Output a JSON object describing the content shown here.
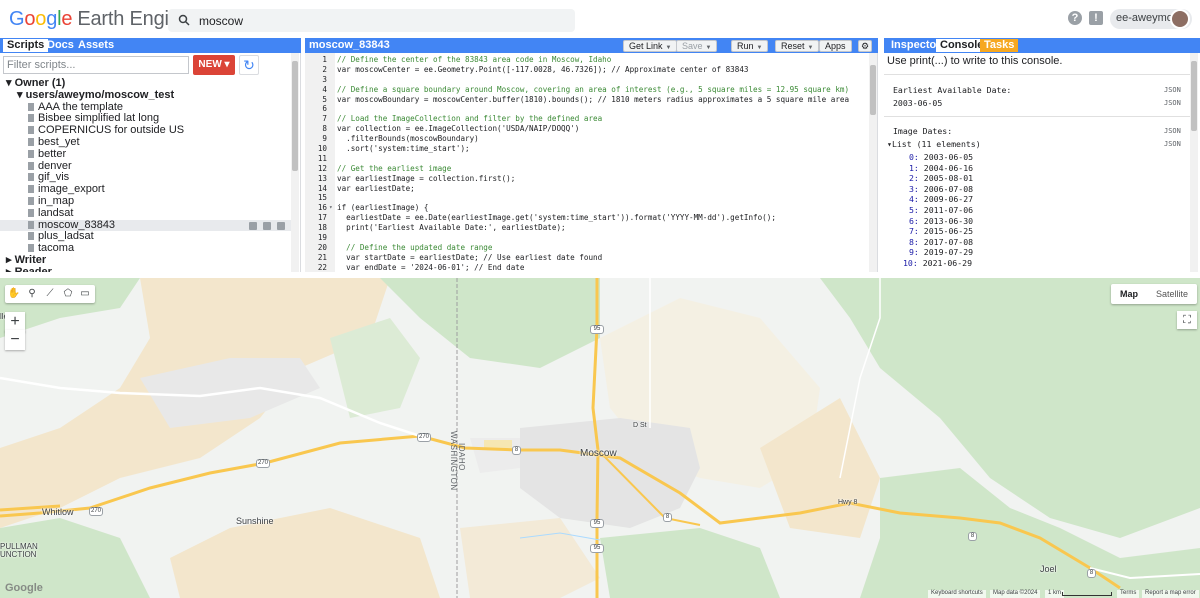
{
  "header": {
    "logo_google": "Google",
    "logo_product": "Earth Engine",
    "search_value": "moscow",
    "help_icon": "help-icon",
    "feedback_icon": "feedback-icon",
    "username": "ee-aweymoui"
  },
  "left_panel": {
    "tabs": [
      "Scripts",
      "Docs",
      "Assets"
    ],
    "filter_placeholder": "Filter scripts...",
    "new_label": "NEW",
    "tree": [
      {
        "label": "Owner (1)",
        "level": 0,
        "type": "group",
        "open": true
      },
      {
        "label": "users/aweymo/moscow_test",
        "level": 1,
        "type": "repo",
        "open": true
      },
      {
        "label": "AAA the template",
        "level": 2,
        "type": "file"
      },
      {
        "label": "Bisbee simplified lat long",
        "level": 2,
        "type": "file"
      },
      {
        "label": "COPERNICUS for outside US",
        "level": 2,
        "type": "file"
      },
      {
        "label": "best_yet",
        "level": 2,
        "type": "file"
      },
      {
        "label": "better",
        "level": 2,
        "type": "file"
      },
      {
        "label": "denver",
        "level": 2,
        "type": "file"
      },
      {
        "label": "gif_vis",
        "level": 2,
        "type": "file"
      },
      {
        "label": "image_export",
        "level": 2,
        "type": "file"
      },
      {
        "label": "in_map",
        "level": 2,
        "type": "file"
      },
      {
        "label": "landsat",
        "level": 2,
        "type": "file"
      },
      {
        "label": "moscow_83843",
        "level": 2,
        "type": "file",
        "selected": true
      },
      {
        "label": "plus_ladsat",
        "level": 2,
        "type": "file"
      },
      {
        "label": "tacoma",
        "level": 2,
        "type": "file"
      },
      {
        "label": "Writer",
        "level": 0,
        "type": "group",
        "open": false
      },
      {
        "label": "Reader",
        "level": 0,
        "type": "group",
        "open": false
      }
    ]
  },
  "editor": {
    "title": "moscow_83843",
    "buttons": {
      "get_link": "Get Link",
      "save": "Save",
      "run": "Run",
      "reset": "Reset",
      "apps": "Apps"
    },
    "lines": [
      {
        "n": "1",
        "text": "// Define the center of the 83843 area code in Moscow, Idaho",
        "comment": true
      },
      {
        "n": "2",
        "text": "var moscowCenter = ee.Geometry.Point([-117.0028, 46.7326]); // Approximate center of 83843"
      },
      {
        "n": "3",
        "text": ""
      },
      {
        "n": "4",
        "text": "// Define a square boundary around Moscow, covering an area of interest (e.g., 5 square miles = 12.95 square km)",
        "comment": true
      },
      {
        "n": "5",
        "text": "var moscowBoundary = moscowCenter.buffer(1810).bounds(); // 1810 meters radius approximates a 5 square mile area"
      },
      {
        "n": "6",
        "text": ""
      },
      {
        "n": "7",
        "text": "// Load the ImageCollection and filter by the defined area",
        "comment": true
      },
      {
        "n": "8",
        "text": "var collection = ee.ImageCollection('USDA/NAIP/DOQQ')"
      },
      {
        "n": "9",
        "text": "  .filterBounds(moscowBoundary)"
      },
      {
        "n": "10",
        "text": "  .sort('system:time_start');"
      },
      {
        "n": "11",
        "text": ""
      },
      {
        "n": "12",
        "text": "// Get the earliest image",
        "comment": true
      },
      {
        "n": "13",
        "text": "var earliestImage = collection.first();"
      },
      {
        "n": "14",
        "text": "var earliestDate;"
      },
      {
        "n": "15",
        "text": ""
      },
      {
        "n": "16",
        "text": "if (earliestImage) {",
        "fold": true
      },
      {
        "n": "17",
        "text": "  earliestDate = ee.Date(earliestImage.get('system:time_start')).format('YYYY-MM-dd').getInfo();"
      },
      {
        "n": "18",
        "text": "  print('Earliest Available Date:', earliestDate);"
      },
      {
        "n": "19",
        "text": ""
      },
      {
        "n": "20",
        "text": "  // Define the updated date range",
        "comment": true
      },
      {
        "n": "21",
        "text": "  var startDate = earliestDate; // Use earliest date found"
      },
      {
        "n": "22",
        "text": "  var endDate = '2024-06-01'; // End date"
      },
      {
        "n": "23",
        "text": ""
      }
    ]
  },
  "console": {
    "tabs": [
      "Inspector",
      "Console",
      "Tasks"
    ],
    "hint": "Use print(...) to write to this console.",
    "earliest_label": "Earliest Available Date:",
    "earliest_value": "2003-06-05",
    "image_dates_label": "Image Dates:",
    "list_label": "List (11 elements)",
    "json": "JSON",
    "dates": [
      {
        "i": "0:",
        "d": "2003-06-05"
      },
      {
        "i": "1:",
        "d": "2004-06-16"
      },
      {
        "i": "2:",
        "d": "2005-08-01"
      },
      {
        "i": "3:",
        "d": "2006-07-08"
      },
      {
        "i": "4:",
        "d": "2009-06-27"
      },
      {
        "i": "5:",
        "d": "2011-07-06"
      },
      {
        "i": "6:",
        "d": "2013-06-30"
      },
      {
        "i": "7:",
        "d": "2015-06-25"
      },
      {
        "i": "8:",
        "d": "2017-07-08"
      },
      {
        "i": "9:",
        "d": "2019-07-29"
      },
      {
        "i": "10:",
        "d": "2021-06-29"
      }
    ]
  },
  "map": {
    "map_label": "Map",
    "satellite_label": "Satellite",
    "places": {
      "moscow": "Moscow",
      "whitlow": "Whitlow",
      "sunshine": "Sunshine",
      "pullman": "PULLMAN",
      "junction": "UNCTION",
      "joel": "Joel",
      "dst": "D St",
      "hwy8": "Hwy 8",
      "edge_le": "lle",
      "idaho": "IDAHO",
      "washington": "WASHINGTON"
    },
    "shields": {
      "s95a": "95",
      "s95b": "95",
      "s95c": "95",
      "s270a": "270",
      "s270b": "270",
      "s270c": "270",
      "s8a": "8",
      "s8b": "8",
      "s8c": "8",
      "s8d": "8"
    },
    "google_label": "Google",
    "attribution": {
      "shortcuts": "Keyboard shortcuts",
      "mapdata": "Map data ©2024",
      "scale": "1 km",
      "terms": "Terms",
      "report": "Report a map error"
    },
    "colors": {
      "road": "#f9c74f",
      "park": "#cfe6c9",
      "field": "#f3e6cc",
      "urban": "#e4e4e4"
    }
  }
}
